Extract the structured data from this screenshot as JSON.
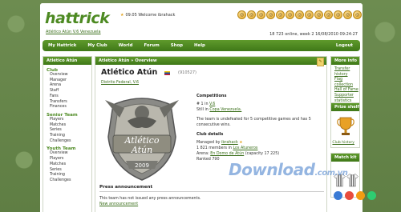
{
  "header": {
    "logo": "hattrick",
    "team_link": "Atlético Atún",
    "team_link_suffix": "V.6 Venezuela",
    "welcome": "09.05 Welcome ibrahack",
    "status": "18 723 online, week 2 16/08/2010 09:24:27",
    "icons": [
      "ball-icon",
      "ball-icon",
      "ball-icon",
      "ball-icon",
      "ball-icon",
      "ball-icon",
      "ball-icon",
      "ball-icon",
      "ball-icon",
      "ball-icon",
      "ball-icon",
      "ball-icon",
      "ball-icon",
      "ball-icon",
      "ball-icon"
    ]
  },
  "nav": {
    "items": [
      "My Hattrick",
      "My Club",
      "World",
      "Forum",
      "Shop",
      "Help"
    ],
    "logout": "Logout"
  },
  "left": {
    "title": "Atlético Atún",
    "sections": [
      {
        "name": "Club",
        "items": [
          "Overview",
          "Manager",
          "Arena",
          "Staff",
          "Fans",
          "Transfers",
          "Finances"
        ]
      },
      {
        "name": "Senior Team",
        "items": [
          "Players",
          "Matches",
          "Series",
          "Training",
          "Challenges"
        ]
      },
      {
        "name": "Youth Team",
        "items": [
          "Overview",
          "Players",
          "Matches",
          "Series",
          "Training",
          "Challenges"
        ]
      }
    ]
  },
  "center": {
    "breadcrumb": "Atlético Atún » Overview",
    "club_name": "Atlético Atún",
    "club_id": "(910527)",
    "club_sub": "Distrito Federal, V.6",
    "crest_text_1": "Atlético",
    "crest_text_2": "Atún",
    "crest_year": "2009",
    "competitions_heading": "Competitions",
    "rank_line_prefix": "# 1 in",
    "rank_league": "V.6",
    "cup_prefix": "Still in",
    "cup_link": "Copa Venezuela.",
    "unbeaten": "The team is undefeated for 5 competitive games and has 5 consecutive wins.",
    "club_info_heading": "Club details",
    "managed_prefix": "Managed by",
    "manager_link": "ibrahack",
    "members_prefix": "1 821 members in",
    "members_link": "Los Atuneros",
    "arena_prefix": "Arena:",
    "arena_link": "En Domo de Atún",
    "arena_capacity": "(capacity 17 225)",
    "ranked": "Ranked 790",
    "press_heading": "Press announcement",
    "press_text": "This team has not issued any press announcements.",
    "press_link": "New announcement"
  },
  "right": {
    "info_title": "More info",
    "links": [
      "Transfer history",
      "Flag collection",
      "Hall of Fame",
      "Supporter statistics",
      "Change team logo"
    ],
    "shelf_title": "Prize shelf",
    "club_history": "Club history",
    "kit_title": "Match kit"
  },
  "watermark": {
    "main": "Download",
    "suffix": ".com.vn"
  },
  "colors": {
    "accent": "#4d8a22",
    "nav": "#3f7818",
    "link": "#3a6e1a"
  }
}
